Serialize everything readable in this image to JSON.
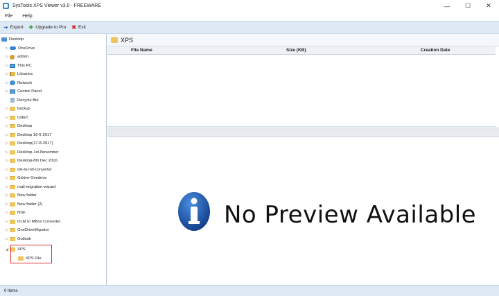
{
  "window": {
    "title": "SysTools XPS Viewer v3.0 - FREEWARE",
    "minimize": "—",
    "maximize": "☐",
    "close": "✕"
  },
  "menu": [
    "File",
    "Help"
  ],
  "toolbar": {
    "export_label": "Export",
    "upgrade_label": "Upgrade to Pro",
    "exit_label": "Exit"
  },
  "tree": {
    "root": "Desktop",
    "items": [
      {
        "label": "OneDrive",
        "icon": "cloud"
      },
      {
        "label": "admin",
        "icon": "user"
      },
      {
        "label": "This PC",
        "icon": "pc"
      },
      {
        "label": "Libraries",
        "icon": "library"
      },
      {
        "label": "Network",
        "icon": "network"
      },
      {
        "label": "Control Panel",
        "icon": "control-panel"
      },
      {
        "label": "Recycle Bin",
        "icon": "recycle-bin"
      },
      {
        "label": "backup",
        "icon": "folder"
      },
      {
        "label": "CNET",
        "icon": "folder"
      },
      {
        "label": "Desktop",
        "icon": "folder"
      },
      {
        "label": "Desktop 16-6-2017",
        "icon": "folder"
      },
      {
        "label": "Desktop(17-8-2017)",
        "icon": "folder"
      },
      {
        "label": "Desktop-1st-November",
        "icon": "folder"
      },
      {
        "label": "Desktop-8th Dec 2016",
        "icon": "folder"
      },
      {
        "label": "dxl-to-nsf-converter",
        "icon": "folder"
      },
      {
        "label": "Gdrive-Onedrive",
        "icon": "folder"
      },
      {
        "label": "mail-migration-wizard",
        "icon": "folder"
      },
      {
        "label": "New folder",
        "icon": "folder"
      },
      {
        "label": "New folder (2)",
        "icon": "folder"
      },
      {
        "label": "NSF",
        "icon": "folder"
      },
      {
        "label": "OLM to MBox Converter",
        "icon": "folder"
      },
      {
        "label": "OneDriveMigrator",
        "icon": "folder"
      },
      {
        "label": "Outlook",
        "icon": "folder"
      },
      {
        "label": "XPS",
        "icon": "folder"
      }
    ],
    "child": "XPS File"
  },
  "panel": {
    "title": "XPS",
    "columns": [
      "File Name",
      "Size (KB)",
      "Creation Date"
    ]
  },
  "preview": {
    "message": "No Preview Available",
    "icon_glyph": "i"
  },
  "status": {
    "text": "0 Items"
  },
  "colors": {
    "toolbar_bg": "#dfe9f5",
    "highlight": "#e03131",
    "info_blue": "#1f5fb5"
  }
}
